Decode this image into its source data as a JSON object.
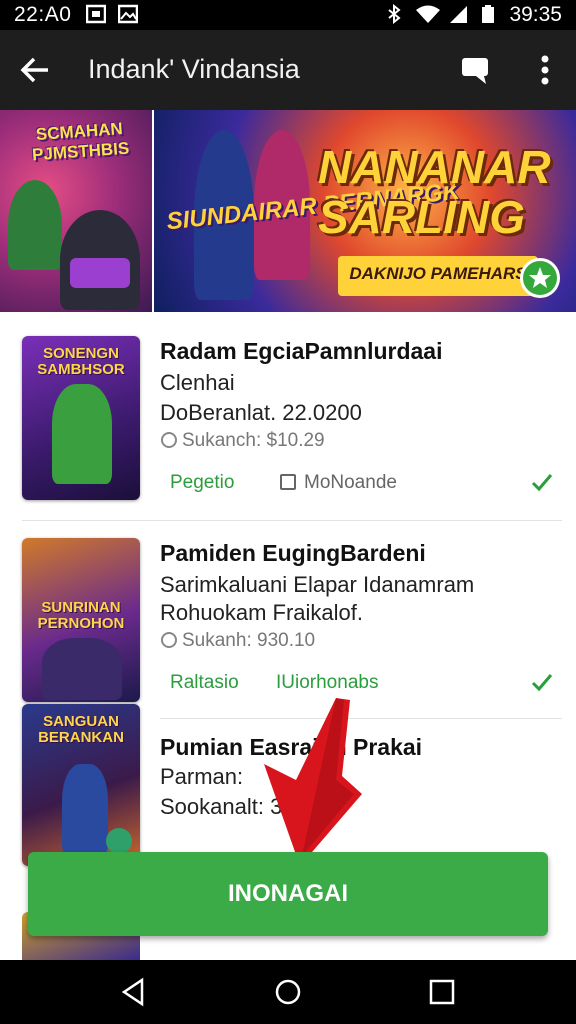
{
  "status_bar": {
    "time_left": "22:A0",
    "time_right": "39:35"
  },
  "app_bar": {
    "title": "Indank' Vindansia"
  },
  "banner": {
    "left_title": "SCMAHAN PJMSTHBIS",
    "mid_title": "SIUNDAIRAR PERNARGK",
    "big_title_line1": "NANANAR",
    "big_title_line2": "SARLING",
    "tagline": "DAKNIJO PAMEHARS"
  },
  "items": [
    {
      "thumb_text": "SONENGN SAMBHSOR",
      "title": "Radam EgciaPamnlurdaai",
      "sub1": "Clenhai",
      "sub2": "DoBeranlat. 22.0200",
      "meta": "Sukanch: $10.29",
      "tag_green": "Pegetio",
      "tag_gray": "MoNoande"
    },
    {
      "thumb_text": "SUNRINAN PERNOHON",
      "title": "Pamiden EugingBardeni",
      "sub1": "Sarimkaluani Elapar Idanamram",
      "sub2": "Rohuokam Fraikalof.",
      "meta": "Sukanh: 930.10",
      "tag_green": "Raltasio",
      "tag_gray": "IUiorhonabs"
    },
    {
      "thumb_text": "SANGUAN BERANKAN",
      "title": "Pumian Easraion Prakai",
      "sub1": "Parman:",
      "sub2": "Sookanalt: 30",
      "meta": ""
    }
  ],
  "cta": {
    "label": "INONAGAI"
  },
  "colors": {
    "accent": "#3aab47",
    "appbar": "#1e1e1e",
    "arrow": "#d8141c"
  }
}
